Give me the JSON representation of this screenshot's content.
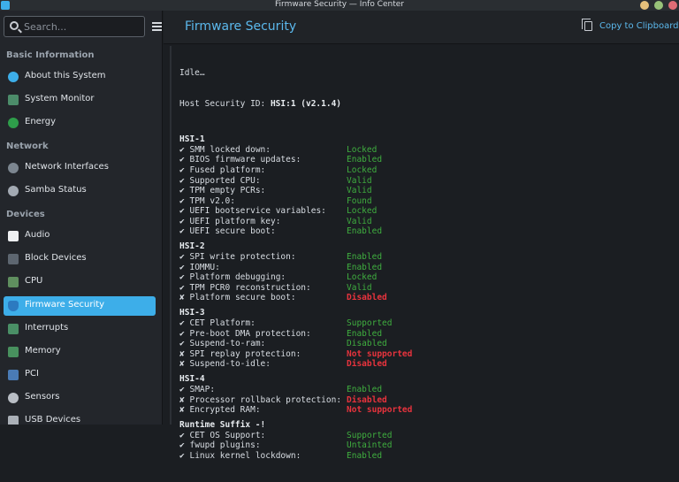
{
  "window": {
    "title": "Firmware Security — Info Center"
  },
  "search": {
    "placeholder": "Search..."
  },
  "sidebar": {
    "sections": [
      {
        "header": "Basic Information"
      },
      {
        "header": "Network"
      },
      {
        "header": "Devices"
      }
    ],
    "items": [
      {
        "label": "About this System",
        "icon": "info-icon"
      },
      {
        "label": "System Monitor",
        "icon": "system-monitor-icon"
      },
      {
        "label": "Energy",
        "icon": "energy-icon"
      },
      {
        "label": "Network Interfaces",
        "icon": "network-icon"
      },
      {
        "label": "Samba Status",
        "icon": "samba-icon"
      },
      {
        "label": "Audio",
        "icon": "audio-icon"
      },
      {
        "label": "Block Devices",
        "icon": "block-devices-icon"
      },
      {
        "label": "CPU",
        "icon": "cpu-icon"
      },
      {
        "label": "Firmware Security",
        "icon": "shield-icon",
        "active": true
      },
      {
        "label": "Interrupts",
        "icon": "interrupts-icon"
      },
      {
        "label": "Memory",
        "icon": "memory-icon"
      },
      {
        "label": "PCI",
        "icon": "pci-icon"
      },
      {
        "label": "Sensors",
        "icon": "sensors-icon"
      },
      {
        "label": "USB Devices",
        "icon": "usb-icon"
      }
    ]
  },
  "header": {
    "title": "Firmware Security",
    "copy_label": "Copy to Clipboard"
  },
  "output": {
    "status": "Idle…",
    "host_id_label": "Host Security ID: ",
    "host_id_value": "HSI:1 (v2.1.4)",
    "groups": [
      {
        "title": "HSI-1",
        "rows": [
          {
            "mark": "✔",
            "label": "SMM locked down:",
            "value": "Locked",
            "ok": true
          },
          {
            "mark": "✔",
            "label": "BIOS firmware updates:",
            "value": "Enabled",
            "ok": true
          },
          {
            "mark": "✔",
            "label": "Fused platform:",
            "value": "Locked",
            "ok": true
          },
          {
            "mark": "✔",
            "label": "Supported CPU:",
            "value": "Valid",
            "ok": true
          },
          {
            "mark": "✔",
            "label": "TPM empty PCRs:",
            "value": "Valid",
            "ok": true
          },
          {
            "mark": "✔",
            "label": "TPM v2.0:",
            "value": "Found",
            "ok": true
          },
          {
            "mark": "✔",
            "label": "UEFI bootservice variables:",
            "value": "Locked",
            "ok": true
          },
          {
            "mark": "✔",
            "label": "UEFI platform key:",
            "value": "Valid",
            "ok": true
          },
          {
            "mark": "✔",
            "label": "UEFI secure boot:",
            "value": "Enabled",
            "ok": true
          }
        ]
      },
      {
        "title": "HSI-2",
        "rows": [
          {
            "mark": "✔",
            "label": "SPI write protection:",
            "value": "Enabled",
            "ok": true
          },
          {
            "mark": "✔",
            "label": "IOMMU:",
            "value": "Enabled",
            "ok": true
          },
          {
            "mark": "✔",
            "label": "Platform debugging:",
            "value": "Locked",
            "ok": true
          },
          {
            "mark": "✔",
            "label": "TPM PCR0 reconstruction:",
            "value": "Valid",
            "ok": true
          },
          {
            "mark": "✘",
            "label": "Platform secure boot:",
            "value": "Disabled",
            "ok": false
          }
        ]
      },
      {
        "title": "HSI-3",
        "rows": [
          {
            "mark": "✔",
            "label": "CET Platform:",
            "value": "Supported",
            "ok": true
          },
          {
            "mark": "✔",
            "label": "Pre-boot DMA protection:",
            "value": "Enabled",
            "ok": true
          },
          {
            "mark": "✔",
            "label": "Suspend-to-ram:",
            "value": "Disabled",
            "ok": true
          },
          {
            "mark": "✘",
            "label": "SPI replay protection:",
            "value": "Not supported",
            "ok": false
          },
          {
            "mark": "✘",
            "label": "Suspend-to-idle:",
            "value": "Disabled",
            "ok": false
          }
        ]
      },
      {
        "title": "HSI-4",
        "rows": [
          {
            "mark": "✔",
            "label": "SMAP:",
            "value": "Enabled",
            "ok": true
          },
          {
            "mark": "✘",
            "label": "Processor rollback protection:",
            "value": "Disabled",
            "ok": false
          },
          {
            "mark": "✘",
            "label": "Encrypted RAM:",
            "value": "Not supported",
            "ok": false
          }
        ]
      },
      {
        "title": "Runtime Suffix -!",
        "rows": [
          {
            "mark": "✔",
            "label": "CET OS Support:",
            "value": "Supported",
            "ok": true
          },
          {
            "mark": "✔",
            "label": "fwupd plugins:",
            "value": "Untainted",
            "ok": true
          },
          {
            "mark": "✔",
            "label": "Linux kernel lockdown:",
            "value": "Enabled",
            "ok": true
          }
        ]
      }
    ]
  },
  "colors": {
    "accent": "#3daee9",
    "ok": "#3fae3f",
    "bad": "#e8333d"
  }
}
